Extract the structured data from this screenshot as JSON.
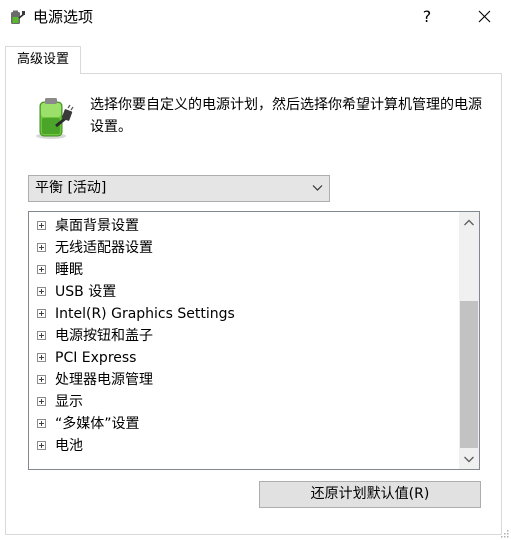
{
  "window": {
    "title": "电源选项",
    "help_label": "?"
  },
  "tabs": [
    {
      "label": "高级设置",
      "active": true
    }
  ],
  "description": "选择你要自定义的电源计划，然后选择你希望计算机管理的电源设置。",
  "plan_select": {
    "selected": "平衡 [活动]"
  },
  "tree": {
    "items": [
      {
        "label": "桌面背景设置"
      },
      {
        "label": "无线适配器设置"
      },
      {
        "label": "睡眠"
      },
      {
        "label": "USB 设置"
      },
      {
        "label": "Intel(R) Graphics Settings"
      },
      {
        "label": "电源按钮和盖子"
      },
      {
        "label": "PCI Express"
      },
      {
        "label": "处理器电源管理"
      },
      {
        "label": "显示"
      },
      {
        "label": "“多媒体”设置"
      },
      {
        "label": "电池"
      }
    ]
  },
  "buttons": {
    "restore_label": "还原计划默认值(R)"
  },
  "icons": {
    "app": "power-options-icon",
    "battery": "battery-plug-icon",
    "close": "close-icon",
    "dropdown": "chevron-down-icon",
    "expander": "plus-box-icon"
  },
  "colors": {
    "select_bg": "#e5e5e5",
    "button_bg": "#e1e1e1",
    "scroll_thumb": "#c2c2c2",
    "battery_green": "#5ab82e"
  }
}
